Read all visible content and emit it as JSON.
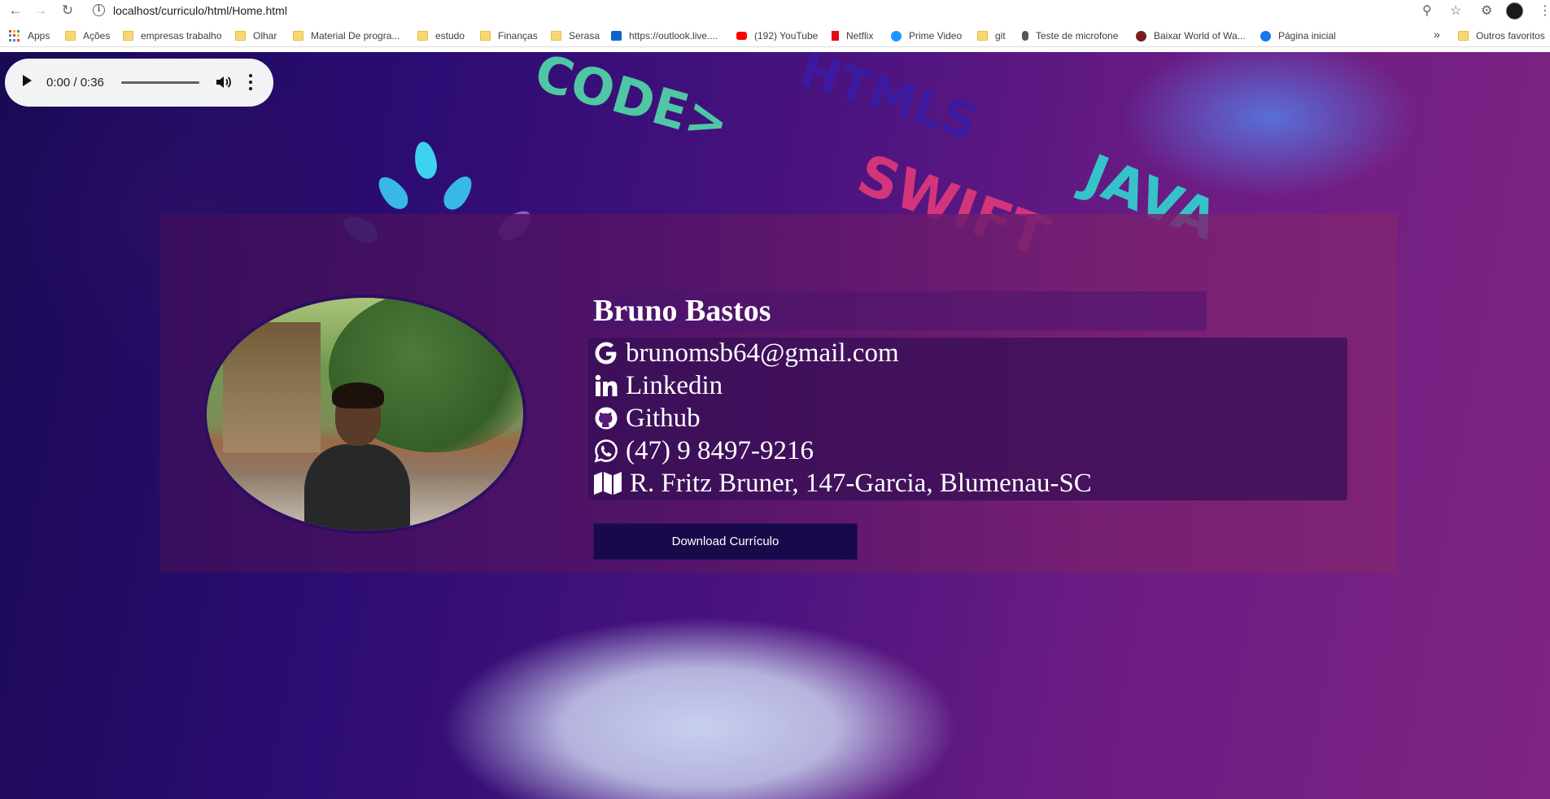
{
  "browser": {
    "url": "localhost/curriculo/html/Home.html",
    "bookmarks": [
      {
        "label": "Apps",
        "icon": "apps-grid-icon"
      },
      {
        "label": "Ações",
        "icon": "folder-icon"
      },
      {
        "label": "empresas trabalho",
        "icon": "folder-icon"
      },
      {
        "label": "Olhar",
        "icon": "folder-icon"
      },
      {
        "label": "Material De progra...",
        "icon": "folder-icon"
      },
      {
        "label": "estudo",
        "icon": "folder-icon"
      },
      {
        "label": "Finanças",
        "icon": "folder-icon"
      },
      {
        "label": "Serasa",
        "icon": "folder-icon"
      },
      {
        "label": "https://outlook.live....",
        "icon": "outlook-icon"
      },
      {
        "label": "(192) YouTube",
        "icon": "youtube-icon"
      },
      {
        "label": "Netflix",
        "icon": "netflix-icon"
      },
      {
        "label": "Prime Video",
        "icon": "prime-video-icon"
      },
      {
        "label": "git",
        "icon": "folder-icon"
      },
      {
        "label": "Teste de microfone",
        "icon": "microphone-icon"
      },
      {
        "label": "Baixar World of Wa...",
        "icon": "wow-icon"
      },
      {
        "label": "Página inicial",
        "icon": "facebook-icon"
      }
    ],
    "other_bookmarks": "Outros favoritos",
    "overflow": "»"
  },
  "audio": {
    "time": "0:00 / 0:36"
  },
  "background_words": {
    "code": "CODE>",
    "html": "HTMLS",
    "swift": "SWIFT",
    "java": "JAVA"
  },
  "profile": {
    "name": "Bruno Bastos",
    "contacts": [
      {
        "icon": "google-icon",
        "text": "brunomsb64@gmail.com"
      },
      {
        "icon": "linkedin-icon",
        "text": "Linkedin"
      },
      {
        "icon": "github-icon",
        "text": "Github"
      },
      {
        "icon": "whatsapp-icon",
        "text": "(47) 9 8497-9216"
      },
      {
        "icon": "map-icon",
        "text": "R. Fritz Bruner, 147-Garcia, Blumenau-SC"
      }
    ],
    "download_label": "Download Currículo"
  }
}
